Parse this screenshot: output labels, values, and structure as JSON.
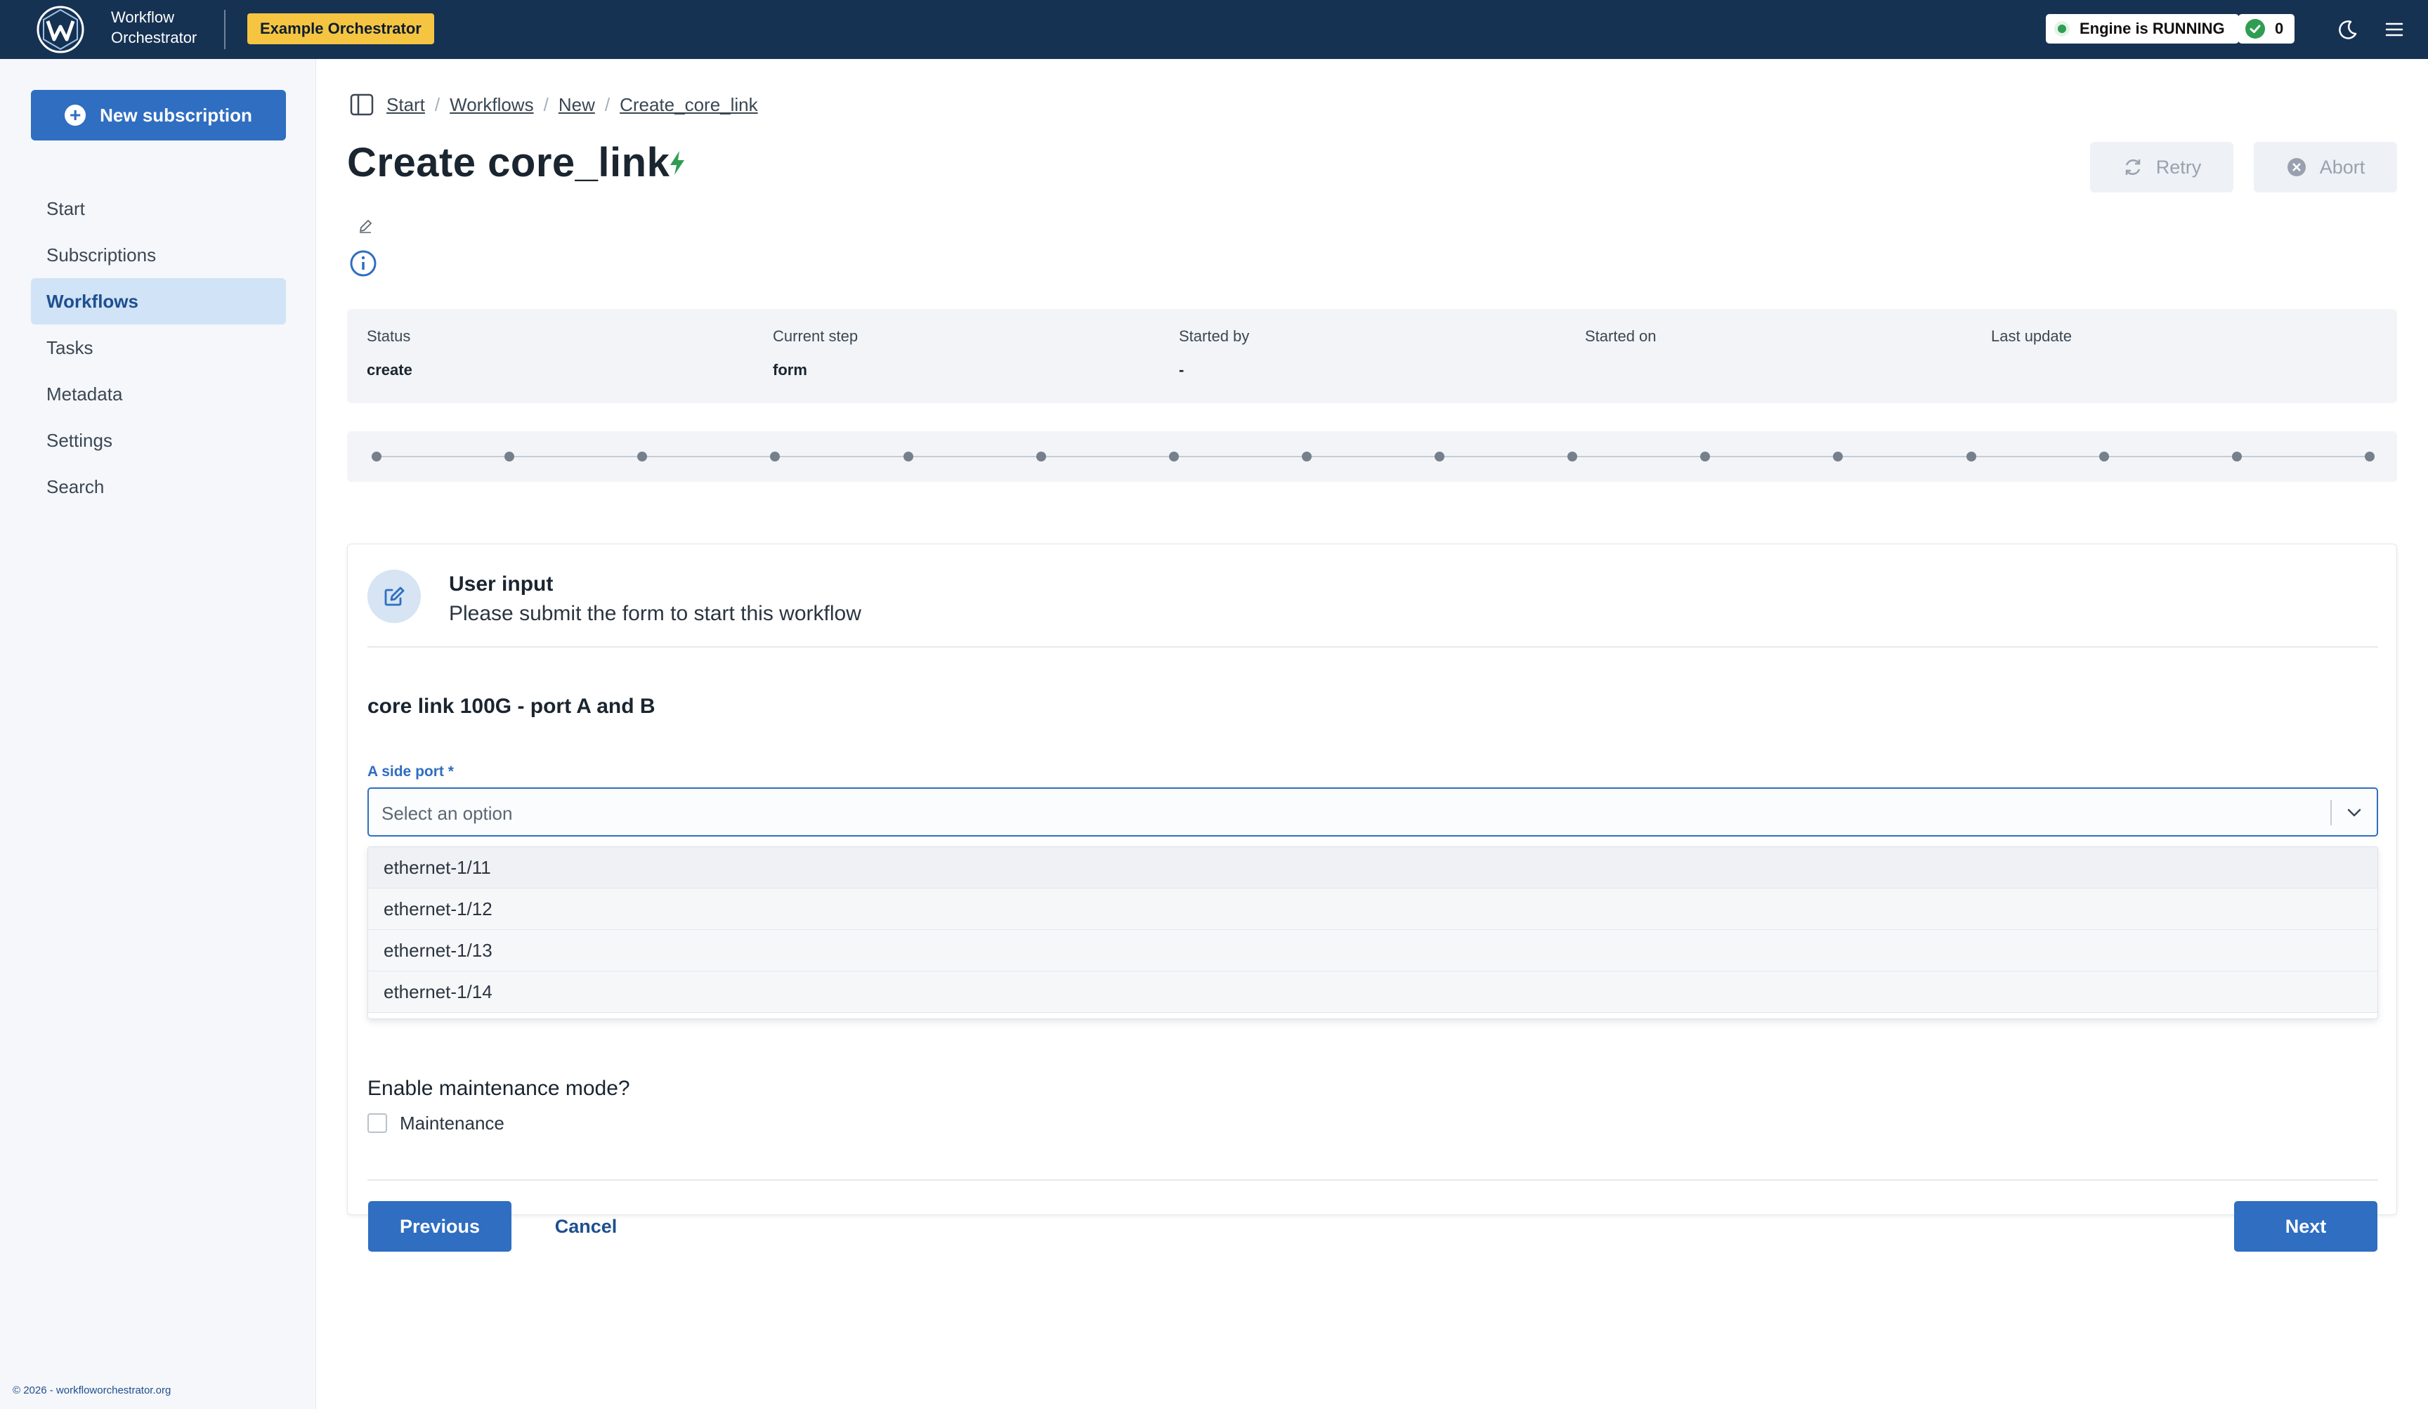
{
  "app": {
    "name_line1": "Workflow",
    "name_line2": "Orchestrator",
    "environment_badge": "Example Orchestrator",
    "engine_status": "Engine is RUNNING",
    "failed_tasks_count": "0",
    "icons": [
      "logo-icon",
      "moon-icon",
      "menu-icon",
      "check-circle-icon"
    ]
  },
  "sidebar": {
    "new_subscription": "New subscription",
    "items": [
      {
        "label": "Start",
        "active": false
      },
      {
        "label": "Subscriptions",
        "active": false
      },
      {
        "label": "Workflows",
        "active": true
      },
      {
        "label": "Tasks",
        "active": false
      },
      {
        "label": "Metadata",
        "active": false
      },
      {
        "label": "Settings",
        "active": false
      },
      {
        "label": "Search",
        "active": false
      }
    ],
    "footer": "© 2026 - workfloworchestrator.org"
  },
  "breadcrumb": [
    "Start",
    "Workflows",
    "New",
    "Create_core_link"
  ],
  "page": {
    "title": "Create core_link",
    "retry_label": "Retry",
    "abort_label": "Abort"
  },
  "info": {
    "status": {
      "label": "Status",
      "value": "create"
    },
    "current_step": {
      "label": "Current step",
      "value": "form"
    },
    "started_by": {
      "label": "Started by",
      "value": "-"
    },
    "started_on": {
      "label": "Started on",
      "value": ""
    },
    "last_update": {
      "label": "Last update",
      "value": ""
    }
  },
  "steps": {
    "count": 16
  },
  "form": {
    "title": "User input",
    "subtitle": "Please submit the form to start this workflow",
    "section_title": "core link 100G - port A and B",
    "a_side_port": {
      "label": "A side port *",
      "placeholder": "Select an option",
      "options": [
        "ethernet-1/11",
        "ethernet-1/12",
        "ethernet-1/13",
        "ethernet-1/14"
      ]
    },
    "maintenance": {
      "question": "Enable maintenance mode?",
      "checkbox_label": "Maintenance",
      "checked": false
    },
    "previous_label": "Previous",
    "cancel_label": "Cancel",
    "next_label": "Next"
  },
  "colors": {
    "topbar": "#163253",
    "primary": "#2f6ec1",
    "badge": "#f5c542",
    "running": "#2f9e52"
  }
}
